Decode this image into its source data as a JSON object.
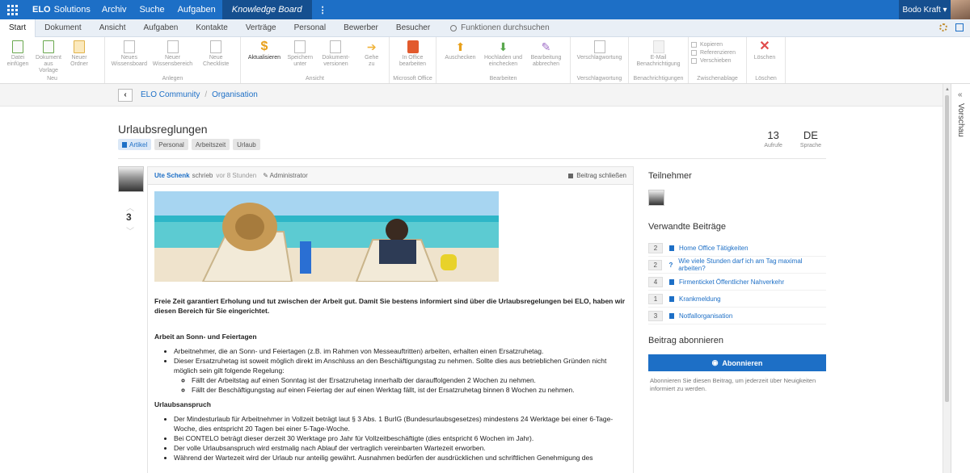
{
  "topbar": {
    "brand_bold": "ELO",
    "brand_rest": "Solutions",
    "nav": [
      "Archiv",
      "Suche",
      "Aufgaben"
    ],
    "active_nav": "Knowledge Board",
    "user": "Bodo Kraft ▾"
  },
  "tabs": [
    "Start",
    "Dokument",
    "Ansicht",
    "Aufgaben",
    "Kontakte",
    "Verträge",
    "Personal",
    "Bewerber",
    "Besucher"
  ],
  "search_placeholder": "Funktionen durchsuchen",
  "ribbon": {
    "groups": {
      "neu": "Neu",
      "anlegen": "Anlegen",
      "ansicht": "Ansicht",
      "office": "Microsoft Office",
      "bearbeiten": "Bearbeiten",
      "verschlagwortung": "Verschlagwortung",
      "benachrichtigungen": "Benachrichtigungen",
      "zwischenablage": "Zwischenablage",
      "loeschen": "Löschen"
    },
    "buttons": {
      "datei": [
        "Datei",
        "einfügen"
      ],
      "dokument": [
        "Dokument",
        "aus Vorlage"
      ],
      "ordner": [
        "Neuer",
        "Ordner"
      ],
      "wissensboard": [
        "Neues",
        "Wissensboard"
      ],
      "wissensbereich": [
        "Neuer",
        "Wissensbereich"
      ],
      "checkliste": [
        "Neue",
        "Checkliste"
      ],
      "aktualisieren": "Aktualisieren",
      "speichern": [
        "Speichern",
        "unter"
      ],
      "versionen": [
        "Dokument-",
        "versionen"
      ],
      "gehe": [
        "Gehe",
        "zu"
      ],
      "office": [
        "In Office",
        "bearbeiten"
      ],
      "auschecken": "Auschecken",
      "hochladen": [
        "Hochladen und",
        "einchecken"
      ],
      "abbrechen": [
        "Bearbeitung",
        "abbrechen"
      ],
      "verschlagwortung": "Verschlagwortung",
      "email": [
        "E-Mail",
        "Benachrichtigung"
      ],
      "kopieren": "Kopieren",
      "referenzieren": "Referenzieren",
      "verschieben": "Verschieben",
      "loeschen": "Löschen"
    }
  },
  "breadcrumb": [
    "ELO Community",
    "Organisation"
  ],
  "article": {
    "title": "Urlaubsreglungen",
    "tags": [
      "Artikel",
      "Personal",
      "Arbeitszeit",
      "Urlaub"
    ],
    "stats": {
      "views": "13",
      "views_label": "Aufrufe",
      "lang": "DE",
      "lang_label": "Sprache"
    },
    "votes": "3"
  },
  "post": {
    "author": "Ute Schenk",
    "verb": "schrieb",
    "time": "vor 8 Stunden",
    "role": "Administrator",
    "close_label": "Beitrag schließen",
    "intro": "Freie Zeit garantiert Erholung und tut zwischen der Arbeit gut. Damit Sie bestens informiert sind über die Urlaubsregelungen bei ELO, haben wir diesen Bereich für Sie eingerichtet.",
    "section1_title": "Arbeit an Sonn- und Feiertagen",
    "section1_items": [
      "Arbeitnehmer, die an Sonn- und Feiertagen (z.B. im Rahmen von Messeauftritten) arbeiten, erhalten einen Ersatzruhetag.",
      "Dieser Ersatzruhetag ist soweit möglich direkt im Anschluss an den Beschäftigungstag zu nehmen. Sollte dies aus betrieblichen Gründen nicht möglich sein gilt folgende Regelung:"
    ],
    "section1_subitems": [
      "Fällt der Arbeitstag auf einen Sonntag ist der Ersatzruhetag innerhalb der darauffolgenden 2 Wochen zu nehmen.",
      "Fällt der Beschäftigungstag auf einen Feiertag der auf einen Werktag fällt, ist der Ersatzruhetag binnen 8 Wochen zu nehmen."
    ],
    "section2_title": "Urlaubsanspruch",
    "section2_items": [
      "Der Mindesturlaub für Arbeitnehmer in Vollzeit beträgt laut § 3 Abs. 1 BurlG (Bundesurlaubsgesetzes) mindestens 24 Werktage bei einer 6-Tage-Woche, dies entspricht 20 Tagen bei einer 5-Tage-Woche.",
      "Bei CONTELO beträgt dieser derzeit 30 Werktage pro Jahr für Vollzeitbeschäftigte (dies entspricht 6 Wochen im Jahr).",
      "Der volle Urlaubsanspruch wird erstmalig nach Ablauf der vertraglich vereinbarten Wartezeit erworben.",
      "Während der Wartezeit wird der Urlaub nur anteilig gewährt. Ausnahmen bedürfen der ausdrücklichen und schriftlichen Genehmigung des"
    ]
  },
  "sidebar": {
    "participants_title": "Teilnehmer",
    "related_title": "Verwandte Beiträge",
    "related": [
      {
        "count": "2",
        "text": "Home Office Tätigkeiten",
        "icon": "book-icon"
      },
      {
        "count": "2",
        "text": "Wie viele Stunden darf ich am Tag maximal arbeiten?",
        "icon": "question-icon"
      },
      {
        "count": "4",
        "text": "Firmenticket Öffentlicher Nahverkehr",
        "icon": "book-icon"
      },
      {
        "count": "1",
        "text": "Krankmeldung",
        "icon": "book-icon"
      },
      {
        "count": "3",
        "text": "Notfallorganisation",
        "icon": "book-icon"
      }
    ],
    "subscribe_title": "Beitrag abonnieren",
    "subscribe_button": "Abonnieren",
    "subscribe_note": "Abonnieren Sie diesen Beitrag, um jederzeit über Neuigkeiten informiert zu werden."
  },
  "preview_label": "Vorschau",
  "colors": {
    "accent": "#1d6fc6",
    "accent_dark": "#154f8f"
  }
}
